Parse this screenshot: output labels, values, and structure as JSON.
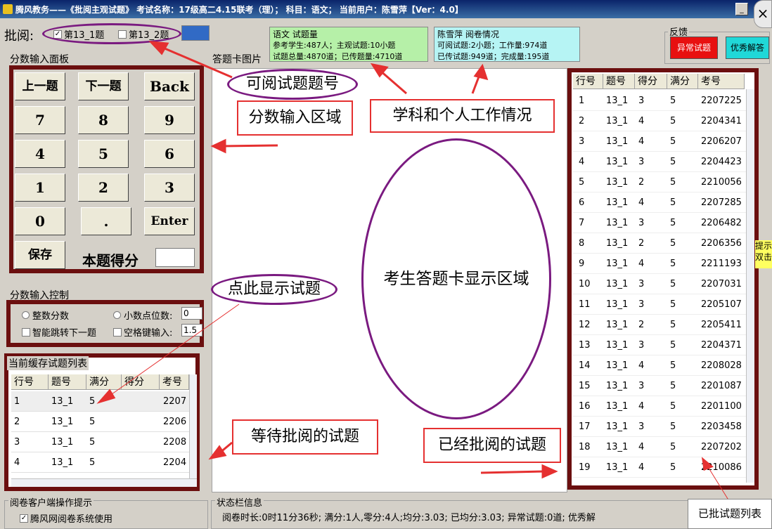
{
  "window": {
    "title": "腾风教务——《批阅主观试题》 考试名称：17级高二4.15联考（理）； 科目：语文； 当前用户：陈雪萍【Ver：4.0】",
    "min_label": "_",
    "close_label": "×"
  },
  "review": {
    "label": "批阅:",
    "questions": [
      {
        "label": "第13_1题",
        "checked": true,
        "mark": "✓"
      },
      {
        "label": "第13_2题",
        "checked": false,
        "mark": ""
      }
    ],
    "progress_percent": 100
  },
  "subject_info": {
    "title": "语文 试题量",
    "line1": "参考学生:487人；主观试题:10小题",
    "line2": "试题总量:4870道；已传题量:4710道"
  },
  "user_info": {
    "title": "陈雪萍 阅卷情况",
    "line1": "可阅试题:2小题；工作量:974道",
    "line2": "已传试题:949道；完成量:195道"
  },
  "feedback": {
    "title": "反馈",
    "abnormal_label": "异常试题",
    "excellent_label": "优秀解答"
  },
  "keypad": {
    "title": "分数输入面板",
    "prev": "上一题",
    "next": "下一题",
    "back": "Back",
    "keys": [
      "7",
      "8",
      "9",
      "4",
      "5",
      "6",
      "1",
      "2",
      "3",
      "0",
      "."
    ],
    "enter": "Enter",
    "save": "保存",
    "score_label": "本题得分"
  },
  "control": {
    "title": "分数输入控制",
    "integer": "整数分数",
    "decimal": "小数点位数:",
    "decimal_value": "0",
    "auto_jump": "智能跳转下一题",
    "space_input": "空格键输入:",
    "space_value": "1.5"
  },
  "cache": {
    "title": "当前缓存试题列表",
    "headers": [
      "行号",
      "题号",
      "满分",
      "得分",
      "考号"
    ],
    "rows": [
      [
        "1",
        "13_1",
        "5",
        "",
        "2207"
      ],
      [
        "2",
        "13_1",
        "5",
        "",
        "2206"
      ],
      [
        "3",
        "13_1",
        "5",
        "",
        "2208"
      ],
      [
        "4",
        "13_1",
        "5",
        "",
        "2204"
      ]
    ]
  },
  "answer_card": {
    "title": "答题卡图片"
  },
  "graded": {
    "headers": [
      "行号",
      "题号",
      "得分",
      "满分",
      "考号"
    ],
    "rows": [
      [
        "1",
        "13_1",
        "3",
        "5",
        "2207225"
      ],
      [
        "2",
        "13_1",
        "4",
        "5",
        "2204341"
      ],
      [
        "3",
        "13_1",
        "4",
        "5",
        "2206207"
      ],
      [
        "4",
        "13_1",
        "3",
        "5",
        "2204423"
      ],
      [
        "5",
        "13_1",
        "2",
        "5",
        "2210056"
      ],
      [
        "6",
        "13_1",
        "4",
        "5",
        "2207285"
      ],
      [
        "7",
        "13_1",
        "3",
        "5",
        "2206482"
      ],
      [
        "8",
        "13_1",
        "2",
        "5",
        "2206356"
      ],
      [
        "9",
        "13_1",
        "4",
        "5",
        "2211193"
      ],
      [
        "10",
        "13_1",
        "3",
        "5",
        "2207031"
      ],
      [
        "11",
        "13_1",
        "3",
        "5",
        "2205107"
      ],
      [
        "12",
        "13_1",
        "2",
        "5",
        "2205411"
      ],
      [
        "13",
        "13_1",
        "3",
        "5",
        "2204371"
      ],
      [
        "14",
        "13_1",
        "4",
        "5",
        "2208028"
      ],
      [
        "15",
        "13_1",
        "3",
        "5",
        "2201087"
      ],
      [
        "16",
        "13_1",
        "4",
        "5",
        "2201100"
      ],
      [
        "17",
        "13_1",
        "3",
        "5",
        "2203458"
      ],
      [
        "18",
        "13_1",
        "4",
        "5",
        "2207202"
      ],
      [
        "19",
        "13_1",
        "4",
        "5",
        "2210086"
      ]
    ]
  },
  "tips": {
    "title": "阅卷客户端操作提示",
    "use_label": "腾风网阅卷系统使用"
  },
  "status": {
    "title": "状态栏信息",
    "text": "阅卷时长:0时11分36秒; 满分:1人,零分:4人;均分:3.03; 已均分:3.03; 异常试题:0道; 优秀解"
  },
  "sticky": {
    "text": "提示双击"
  },
  "annotations": {
    "question_no": "可阅试题题号",
    "input_area": "分数输入区域",
    "work_status": "学科和个人工作情况",
    "answer_area": "考生答题卡显示区域",
    "click_show": "点此显示试题",
    "pending": "等待批阅的试题",
    "graded": "已经批阅的试题",
    "graded_list": "已批试题列表"
  },
  "colors": {
    "frame": "#6b0f0f",
    "annotation_red": "#e53030",
    "annotation_purple": "#7a1a80",
    "abnormal_btn": "#e81010",
    "excellent_btn": "#20d8d8"
  }
}
